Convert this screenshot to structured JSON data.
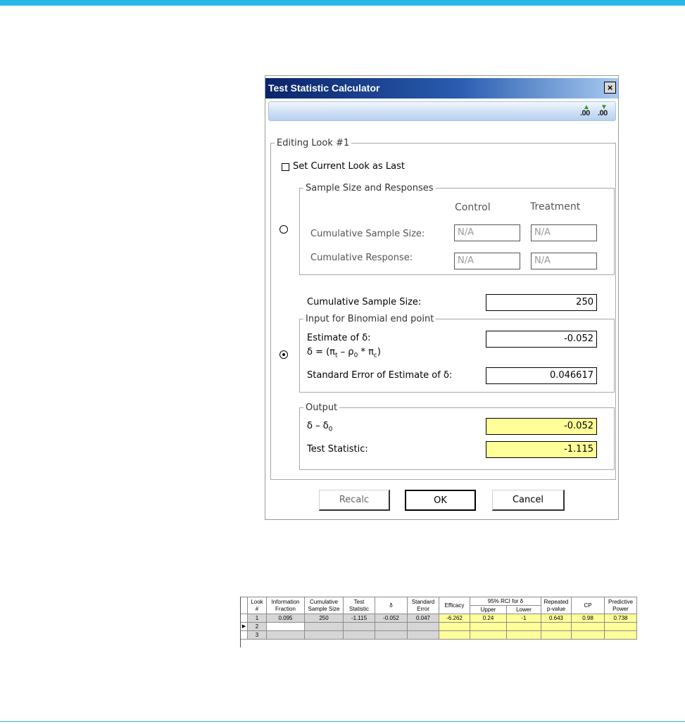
{
  "dialog": {
    "title": "Test Statistic Calculator",
    "close_label": "×",
    "toolbar": {
      "increase_label": ".00",
      "decrease_label": ".00"
    },
    "editing_group": "Editing Look #1",
    "set_last_label": "Set Current Look as Last",
    "set_last_checked": false,
    "sample_group": {
      "legend": "Sample Size and Responses",
      "col_control": "Control",
      "col_treatment": "Treatment",
      "row1_label": "Cumulative Sample Size:",
      "row2_label": "Cumulative Response:",
      "control_size": "N/A",
      "treatment_size": "N/A",
      "control_response": "N/A",
      "treatment_response": "N/A",
      "selected": false
    },
    "cumulative_label": "Cumulative Sample Size:",
    "cumulative_value": "250",
    "binomial_group": {
      "legend": "Input for Binomial end point",
      "estimate_label": "Estimate of δ:",
      "formula_prefix": "δ = (π",
      "formula_t": "t",
      "formula_mid": " – ρ",
      "formula_0": "0",
      "formula_mid2": " * π",
      "formula_c": "c",
      "formula_end": ")",
      "estimate_value": "-0.052",
      "se_label": "Standard Error of Estimate of δ:",
      "se_value": "0.046617",
      "selected": true
    },
    "output_group": {
      "legend": "Output",
      "delta_label": "δ – δ",
      "delta_sub": "0",
      "delta_value": "-0.052",
      "stat_label": "Test Statistic:",
      "stat_value": "-1.115"
    },
    "buttons": {
      "recalc": "Recalc",
      "ok": "OK",
      "cancel": "Cancel"
    }
  },
  "grid": {
    "headers": [
      [
        "Look",
        "#"
      ],
      [
        "Information",
        "Fraction"
      ],
      [
        "Cumulative",
        "Sample Size"
      ],
      [
        "Test",
        "Statistic"
      ],
      [
        "δ",
        ""
      ],
      [
        "Standard",
        "Error"
      ],
      [
        "Efficacy",
        ""
      ],
      [
        "Repeated",
        "p-value"
      ],
      [
        "CP",
        ""
      ],
      [
        "Predictive",
        "Power"
      ]
    ],
    "rci_header": "95% RCI for δ",
    "rci_upper": "Upper",
    "rci_lower": "Lower",
    "row_indicator": "▶",
    "rows": [
      [
        "1",
        "0.095",
        "250",
        "-1.115",
        "-0.052",
        "0.047",
        "-6.262",
        "0.24",
        "-1",
        "0.643",
        "0.98",
        "0.738"
      ],
      [
        "2",
        "",
        "",
        "",
        "",
        "",
        "",
        "",
        "",
        "",
        "",
        ""
      ],
      [
        "3",
        "",
        "",
        "",
        "",
        "",
        "",
        "",
        "",
        "",
        "",
        ""
      ]
    ]
  },
  "colors": {
    "accent": "#29b6e8",
    "title_gradient_start": "#0a246a",
    "output_fill": "#ffff99"
  }
}
